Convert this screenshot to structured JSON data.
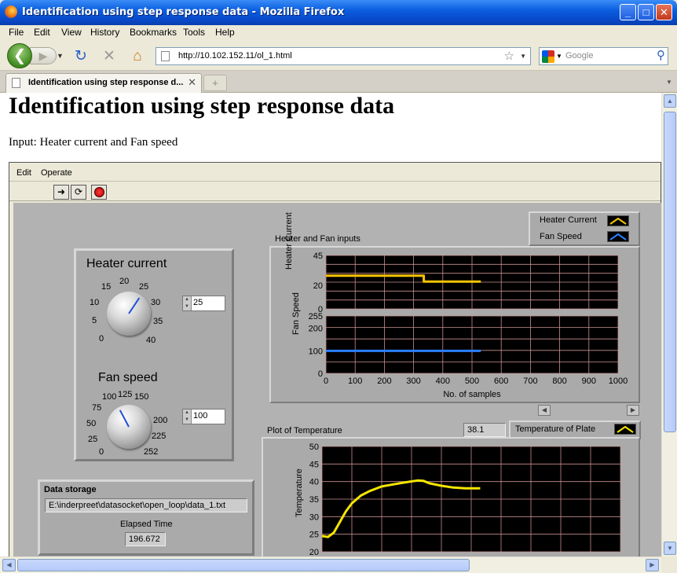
{
  "window": {
    "title": "Identification using step response data - Mozilla Firefox",
    "controls": {
      "minimize": "_",
      "maximize": "□",
      "close": "✕"
    }
  },
  "menu": [
    "File",
    "Edit",
    "View",
    "History",
    "Bookmarks",
    "Tools",
    "Help"
  ],
  "nav": {
    "back_icon": "back-arrow-icon",
    "forward_icon": "forward-arrow-icon",
    "url": "http://10.102.152.11/ol_1.html",
    "search_placeholder": "Google"
  },
  "tabs": [
    {
      "label": "Identification using step response d...",
      "active": true
    }
  ],
  "page": {
    "heading": "Identification using step response data",
    "subtitle": "Input: Heater current and Fan speed"
  },
  "labview": {
    "menu": [
      "Edit",
      "Operate"
    ],
    "toolbar": [
      "run-arrow-icon",
      "run-continuous-icon",
      "abort-stop-icon"
    ],
    "heater": {
      "label": "Heater current",
      "value": "25",
      "value_num": 25,
      "scale": [
        "0",
        "5",
        "10",
        "15",
        "20",
        "25",
        "30",
        "35",
        "40"
      ],
      "min": 0,
      "max": 40
    },
    "fan": {
      "label": "Fan speed",
      "value": "100",
      "value_num": 100,
      "scale": [
        "0",
        "25",
        "50",
        "75",
        "100",
        "125",
        "150",
        "200",
        "225",
        "252"
      ],
      "min": 0,
      "max": 252
    },
    "storage": {
      "label": "Data storage",
      "path": "E:\\inderpreet\\datasocket\\open_loop\\data_1.txt",
      "elapsed_label": "Elapsed Time",
      "elapsed": "196.672"
    },
    "inputs_chart": {
      "title": "Heater and Fan inputs",
      "legend": [
        "Heater Current",
        "Fan Speed"
      ],
      "heater_axis_label": "Heater Current",
      "heater_ticks": [
        "45",
        "20",
        "0"
      ],
      "fan_axis_label": "Fan Speed",
      "fan_ticks": [
        "255",
        "200",
        "100",
        "0"
      ],
      "x_label": "No. of samples",
      "x_ticks": [
        "0",
        "100",
        "200",
        "300",
        "400",
        "500",
        "600",
        "700",
        "800",
        "900",
        "1000"
      ]
    },
    "temp_chart": {
      "title": "Plot of Temperature",
      "current_value": "38.1",
      "legend": "Temperature of Plate",
      "y_label": "Temperature",
      "y_ticks": [
        "50",
        "45",
        "40",
        "35",
        "30",
        "25",
        "20"
      ]
    }
  },
  "chart_data": [
    {
      "type": "line",
      "title": "Heater and Fan inputs",
      "xlabel": "No. of samples",
      "ylabel": "Heater Current",
      "xlim": [
        0,
        1000
      ],
      "ylim": [
        0,
        45
      ],
      "series": [
        {
          "name": "Heater Current",
          "color": "#f5c400",
          "x": [
            0,
            335,
            335,
            530
          ],
          "values": [
            28,
            28,
            23,
            23
          ]
        }
      ]
    },
    {
      "type": "line",
      "title": "",
      "xlabel": "No. of samples",
      "ylabel": "Fan Speed",
      "xlim": [
        0,
        1000
      ],
      "ylim": [
        0,
        255
      ],
      "series": [
        {
          "name": "Fan Speed",
          "color": "#2a7fff",
          "x": [
            0,
            530
          ],
          "values": [
            100,
            100
          ]
        }
      ]
    },
    {
      "type": "line",
      "title": "Plot of Temperature",
      "ylabel": "Temperature",
      "ylim": [
        20,
        50
      ],
      "xlim": [
        0,
        1000
      ],
      "series": [
        {
          "name": "Temperature of Plate",
          "color": "#f5e600",
          "x": [
            0,
            20,
            40,
            60,
            80,
            100,
            130,
            160,
            200,
            240,
            280,
            320,
            340,
            360,
            400,
            440,
            480,
            530
          ],
          "values": [
            24.5,
            24.2,
            25.5,
            28.5,
            31.5,
            33.8,
            36,
            37.3,
            38.6,
            39.2,
            39.8,
            40.3,
            40.2,
            39.5,
            38.8,
            38.3,
            38.1,
            38.1
          ]
        }
      ]
    }
  ]
}
